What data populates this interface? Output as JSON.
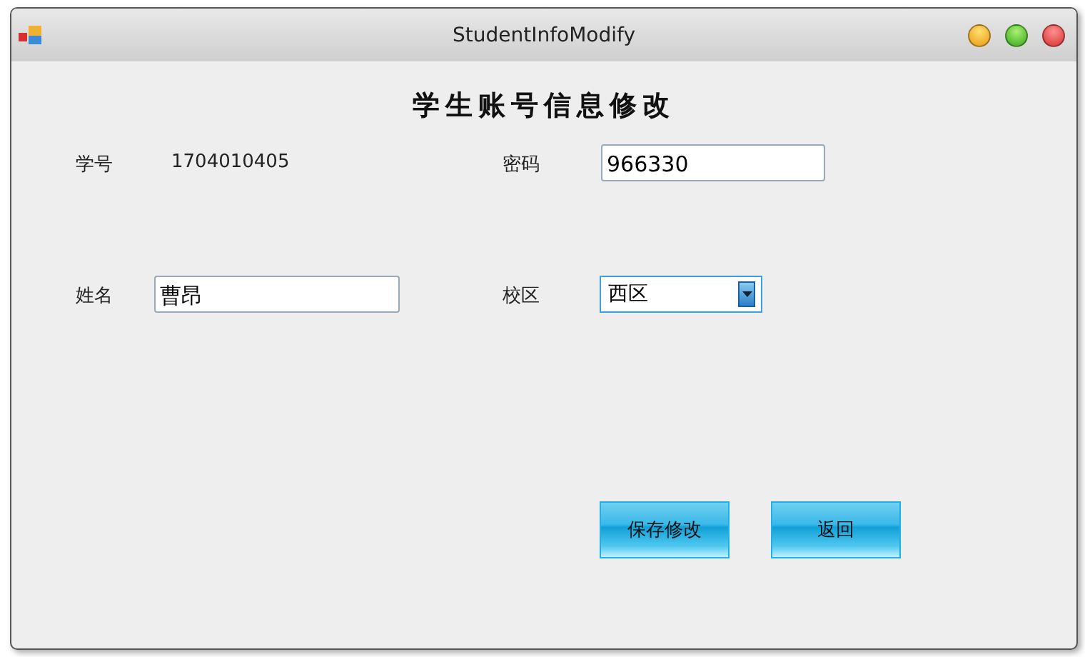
{
  "window": {
    "title": "StudentInfoModify"
  },
  "heading": "学生账号信息修改",
  "fields": [
    {
      "label": "学号",
      "kind": "text",
      "value": "1704010405"
    },
    {
      "label": "密码",
      "kind": "input",
      "value": "966330"
    },
    {
      "label": "姓名",
      "kind": "input",
      "value": "曹昂"
    },
    {
      "label": "校区",
      "kind": "dropdown",
      "value": "西区"
    }
  ],
  "buttons": [
    "保存修改",
    "返回"
  ]
}
